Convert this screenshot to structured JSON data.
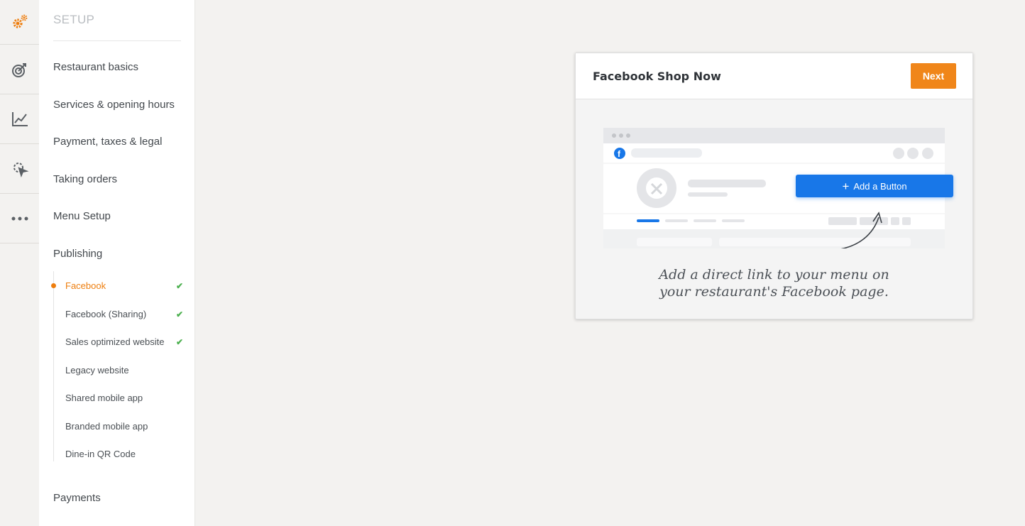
{
  "rail": {
    "items": [
      {
        "icon": "gears-icon",
        "active": true
      },
      {
        "icon": "target-icon"
      },
      {
        "icon": "chart-line-icon"
      },
      {
        "icon": "cursor-gear-icon"
      },
      {
        "icon": "more-dots-icon"
      }
    ]
  },
  "sidebar": {
    "title": "SETUP",
    "items": [
      {
        "label": "Restaurant basics"
      },
      {
        "label": "Services & opening hours"
      },
      {
        "label": "Payment, taxes & legal"
      },
      {
        "label": "Taking orders"
      },
      {
        "label": "Menu Setup"
      },
      {
        "label": "Publishing"
      }
    ],
    "sub_items": [
      {
        "label": "Facebook",
        "active": true,
        "done": true
      },
      {
        "label": "Facebook (Sharing)",
        "done": true
      },
      {
        "label": "Sales optimized website",
        "done": true
      },
      {
        "label": "Legacy website"
      },
      {
        "label": "Shared mobile app"
      },
      {
        "label": "Branded mobile app"
      },
      {
        "label": "Dine-in QR Code"
      }
    ],
    "bottom_item": {
      "label": "Payments"
    }
  },
  "card": {
    "title": "Facebook Shop Now",
    "next_label": "Next",
    "mock_button_label": "Add a Button",
    "caption_line1": "Add a direct link to your menu on",
    "caption_line2": "your restaurant's Facebook page."
  },
  "colors": {
    "accent": "#f0861a",
    "facebook_blue": "#1877e8",
    "check_green": "#4cb04f"
  }
}
